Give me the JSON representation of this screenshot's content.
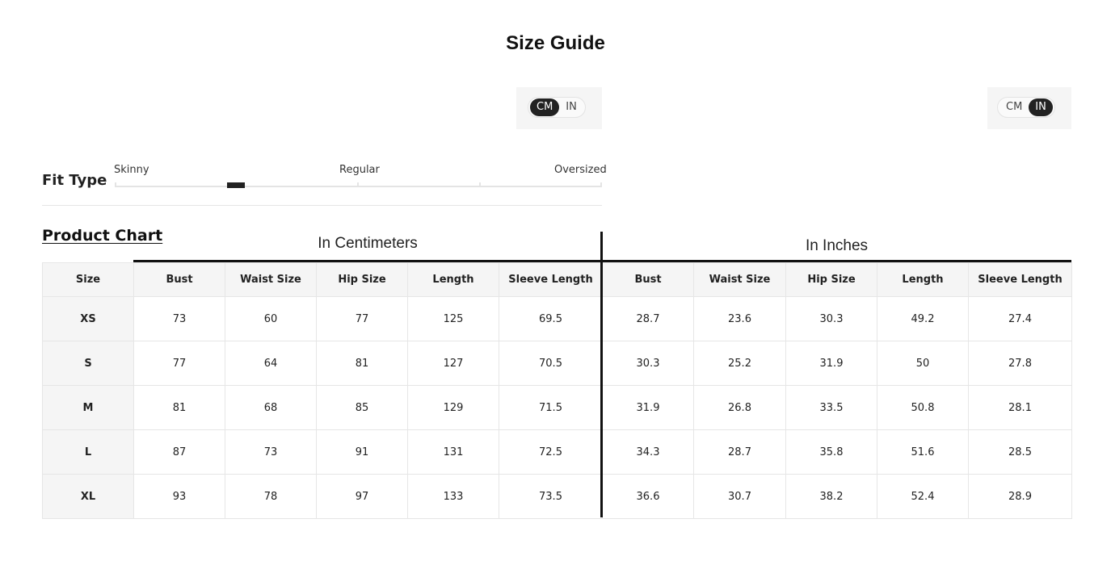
{
  "title": "Size Guide",
  "unit_toggle_left": {
    "options": [
      "CM",
      "IN"
    ],
    "active": "CM"
  },
  "unit_toggle_right": {
    "options": [
      "CM",
      "IN"
    ],
    "active": "IN"
  },
  "fit_type": {
    "label": "Fit Type",
    "scale": [
      "Skinny",
      "Regular",
      "Oversized"
    ],
    "selected_position": 0.25
  },
  "product_chart": {
    "title": "Product Chart",
    "cm_heading": "In Centimeters",
    "in_heading": "In Inches",
    "headers": [
      "Size",
      "Bust",
      "Waist Size",
      "Hip Size",
      "Length",
      "Sleeve Length",
      "Bust",
      "Waist Size",
      "Hip Size",
      "Length",
      "Sleeve Length"
    ],
    "rows": [
      [
        "XS",
        "73",
        "60",
        "77",
        "125",
        "69.5",
        "28.7",
        "23.6",
        "30.3",
        "49.2",
        "27.4"
      ],
      [
        "S",
        "77",
        "64",
        "81",
        "127",
        "70.5",
        "30.3",
        "25.2",
        "31.9",
        "50",
        "27.8"
      ],
      [
        "M",
        "81",
        "68",
        "85",
        "129",
        "71.5",
        "31.9",
        "26.8",
        "33.5",
        "50.8",
        "28.1"
      ],
      [
        "L",
        "87",
        "73",
        "91",
        "131",
        "72.5",
        "34.3",
        "28.7",
        "35.8",
        "51.6",
        "28.5"
      ],
      [
        "XL",
        "93",
        "78",
        "97",
        "133",
        "73.5",
        "36.6",
        "30.7",
        "38.2",
        "52.4",
        "28.9"
      ]
    ]
  }
}
